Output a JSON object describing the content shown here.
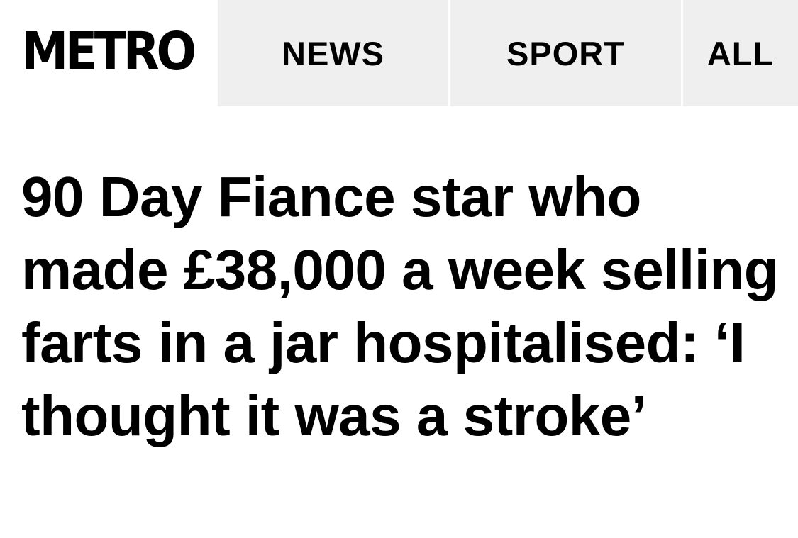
{
  "header": {
    "logo": "METRO",
    "nav": [
      {
        "label": "NEWS"
      },
      {
        "label": "SPORT"
      },
      {
        "label": "ALL"
      }
    ]
  },
  "article": {
    "headline": "90 Day Fiance star who made £38,000 a week selling farts in a jar hospitalised: ‘I thought it was a stroke’"
  }
}
